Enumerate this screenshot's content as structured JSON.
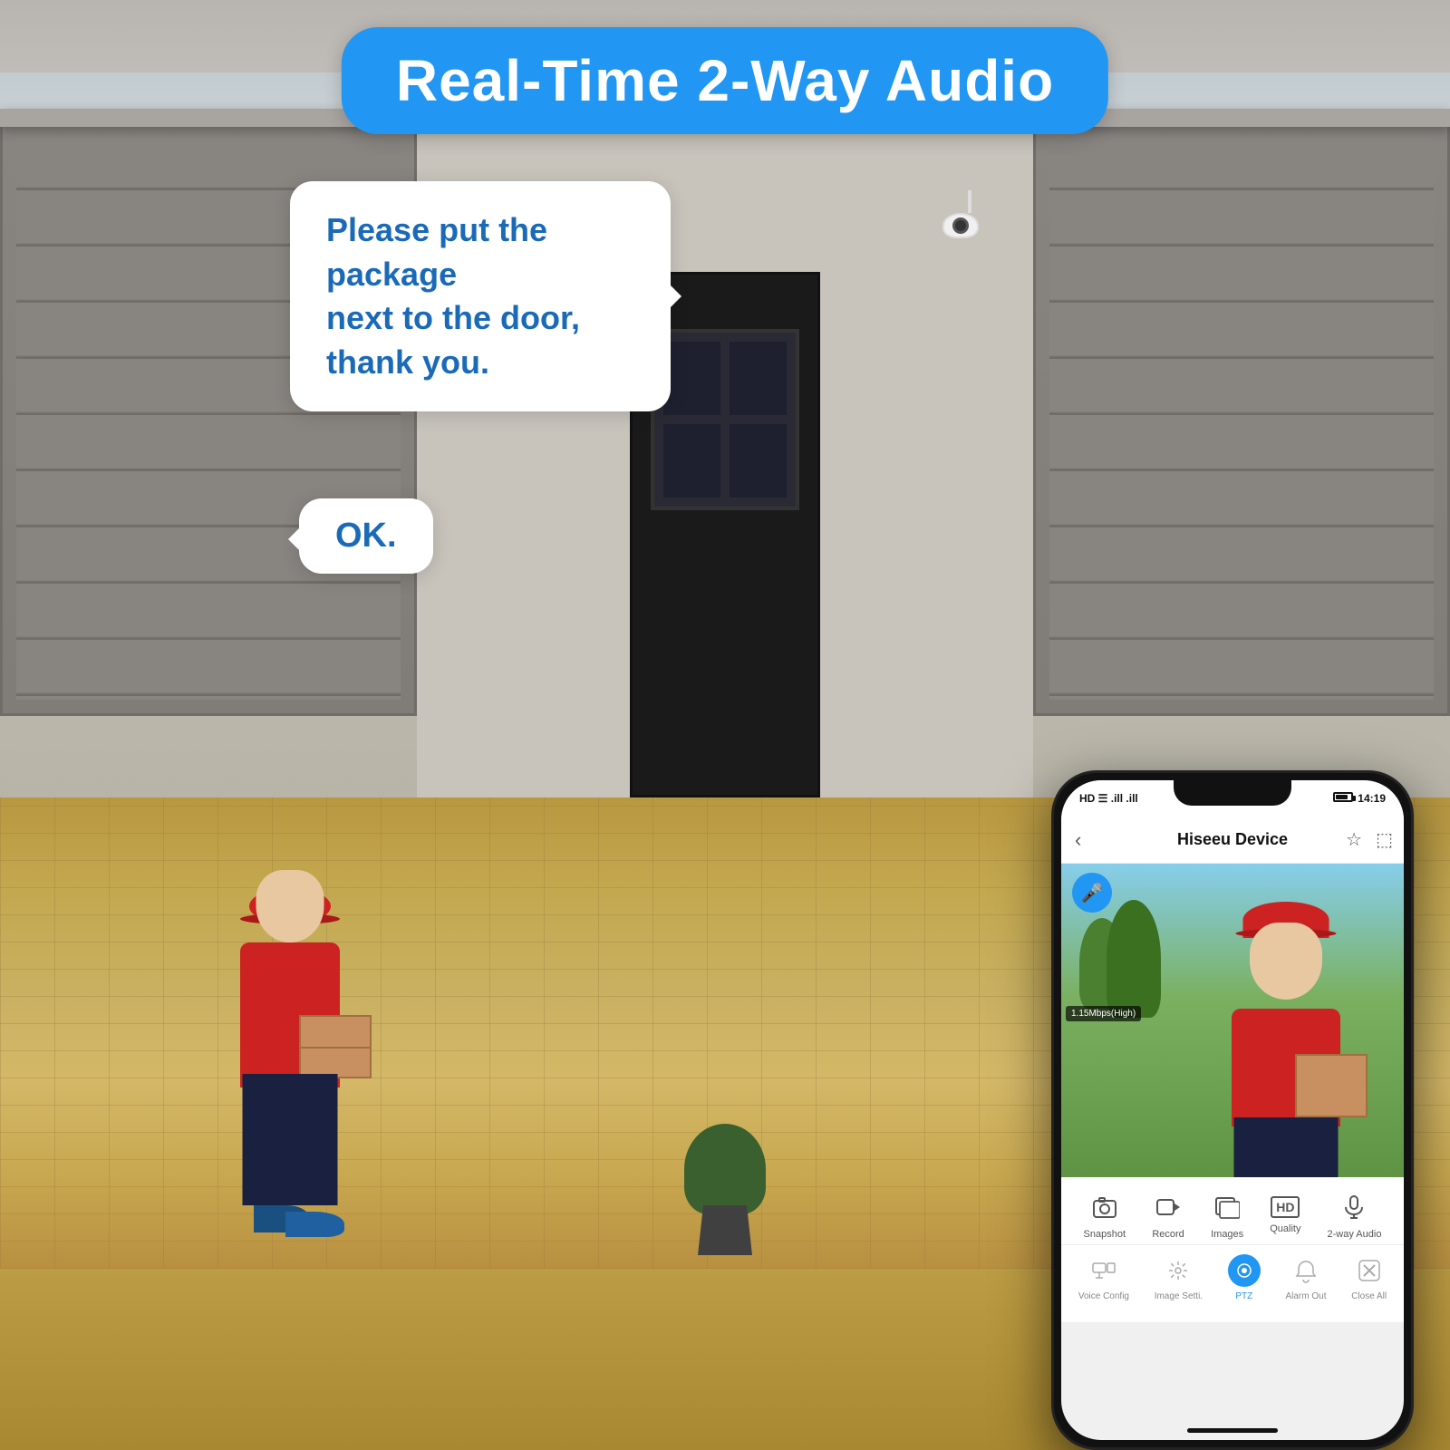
{
  "title": "Real-Time 2-Way Audio",
  "speechBubble1": {
    "text": "Please put the package\nnext to the door, thank you."
  },
  "speechBubble2": {
    "text": "OK."
  },
  "phone": {
    "statusBar": {
      "left": "HD ☰ .ill .ill",
      "time": "14:19",
      "battery": "80"
    },
    "appTitle": "Hiseeu Device",
    "bitrate": "1.15Mbps(High)",
    "controls1": [
      {
        "icon": "📷",
        "label": "Snapshot"
      },
      {
        "icon": "⏺",
        "label": "Record"
      },
      {
        "icon": "🖼",
        "label": "Images"
      },
      {
        "icon": "HD",
        "label": "Quality"
      },
      {
        "icon": "🎤",
        "label": "2-way Audio"
      }
    ],
    "controls2": [
      {
        "icon": "👁",
        "label": "Voice Config",
        "type": "normal"
      },
      {
        "icon": "⚙",
        "label": "Image Setti.",
        "type": "normal"
      },
      {
        "icon": "◎",
        "label": "PTZ",
        "type": "ptz"
      },
      {
        "icon": "🔔",
        "label": "Alarm Out",
        "type": "normal"
      },
      {
        "icon": "✕",
        "label": "Close All",
        "type": "normal"
      }
    ]
  }
}
